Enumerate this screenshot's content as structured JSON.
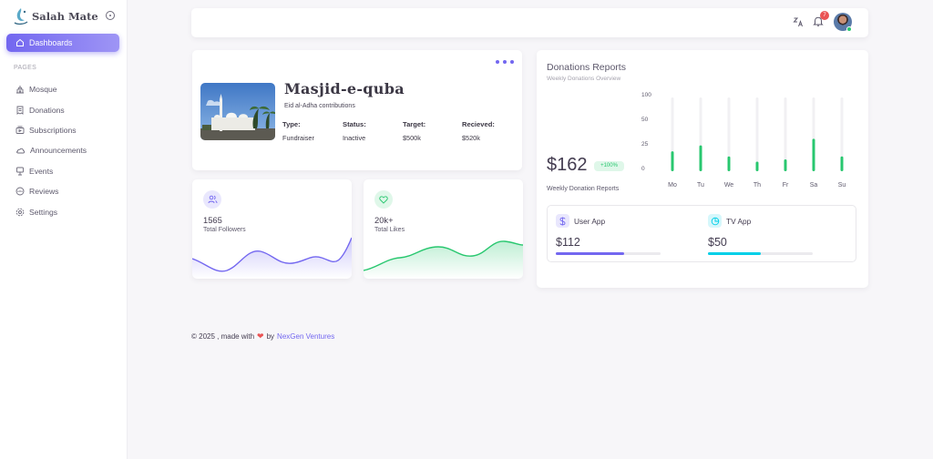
{
  "app": {
    "name": "Salah Mate"
  },
  "icons": {
    "collapse": "circle-dot-icon",
    "dashboard": "home-icon",
    "language": "translate-icon",
    "notifications": "bell-icon",
    "menu": "dots-horizontal-icon"
  },
  "sidebar": {
    "active_label": "Dashboards",
    "section_header": "PAGES",
    "items": [
      {
        "label": "Mosque",
        "icon": "mosque-icon"
      },
      {
        "label": "Donations",
        "icon": "receipt-icon"
      },
      {
        "label": "Subscriptions",
        "icon": "subscriptions-icon"
      },
      {
        "label": "Announcements",
        "icon": "cloud-icon"
      },
      {
        "label": "Events",
        "icon": "presentation-icon"
      },
      {
        "label": "Reviews",
        "icon": "rating-icon"
      },
      {
        "label": "Settings",
        "icon": "gear-icon"
      }
    ]
  },
  "header": {
    "notification_count": "7"
  },
  "mosque": {
    "name": "Masjid-e-quba",
    "subtitle": "Eid al-Adha contributions",
    "fields": [
      {
        "label": "Type:",
        "value": "Fundraiser"
      },
      {
        "label": "Status:",
        "value": "Inactive"
      },
      {
        "label": "Target:",
        "value": "$500k"
      },
      {
        "label": "Recieved:",
        "value": "$520k"
      }
    ]
  },
  "stats": [
    {
      "value": "1565",
      "label": "Total Followers",
      "icon": "users-icon",
      "color": "#7367f0"
    },
    {
      "value": "20k+",
      "label": "Total Likes",
      "icon": "heart-icon",
      "color": "#28c76f"
    }
  ],
  "donations": {
    "title": "Donations Reports",
    "subtitle": "Weekly Donations Overview",
    "amount": "$162",
    "badge": "+100%",
    "caption": "Weekly Donation Reports"
  },
  "chart_data": {
    "type": "bar",
    "categories": [
      "Mo",
      "Tu",
      "We",
      "Th",
      "Fr",
      "Sa",
      "Su"
    ],
    "values": [
      27,
      35,
      20,
      13,
      16,
      44,
      20
    ],
    "yticks": [
      "100",
      "50",
      "25",
      "0"
    ],
    "ylim": [
      0,
      100
    ],
    "bar_color": "#28c76f",
    "track_color": "#f1f0f3"
  },
  "apps": [
    {
      "name": "User App",
      "value": "$112",
      "progress": 0.65,
      "color": "#7367f0",
      "icon": "dollar-icon"
    },
    {
      "name": "TV App",
      "value": "$50",
      "progress": 0.5,
      "color": "#00cfe8",
      "icon": "pie-chart-icon"
    }
  ],
  "footer": {
    "prefix": "© 2025 , made with",
    "by": "by",
    "company": "NexGen Ventures"
  }
}
